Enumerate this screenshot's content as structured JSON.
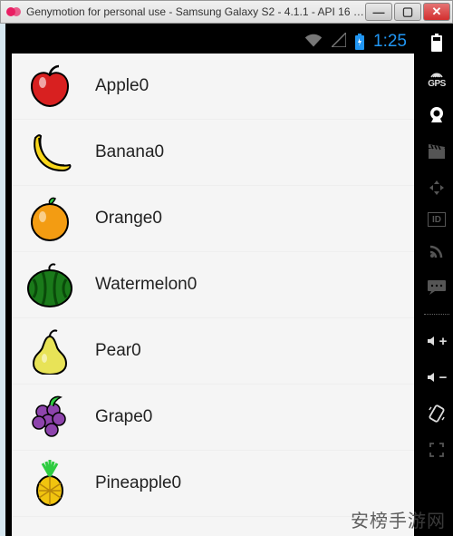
{
  "window": {
    "title": "Genymotion for personal use - Samsung Galaxy S2 - 4.1.1 - API 16 - ..."
  },
  "status_bar": {
    "clock": "1:25"
  },
  "list": {
    "items": [
      {
        "label": "Apple0",
        "icon": "apple-icon"
      },
      {
        "label": "Banana0",
        "icon": "banana-icon"
      },
      {
        "label": "Orange0",
        "icon": "orange-icon"
      },
      {
        "label": "Watermelon0",
        "icon": "watermelon-icon"
      },
      {
        "label": "Pear0",
        "icon": "pear-icon"
      },
      {
        "label": "Grape0",
        "icon": "grape-icon"
      },
      {
        "label": "Pineapple0",
        "icon": "pineapple-icon"
      }
    ]
  },
  "sidebar": {
    "gps_label": "GPS",
    "id_label": "ID",
    "vol_up": "+",
    "vol_down": "−"
  },
  "win_buttons": {
    "min": "—",
    "max": "▢",
    "close": "✕"
  },
  "watermark": "安榜手游网"
}
